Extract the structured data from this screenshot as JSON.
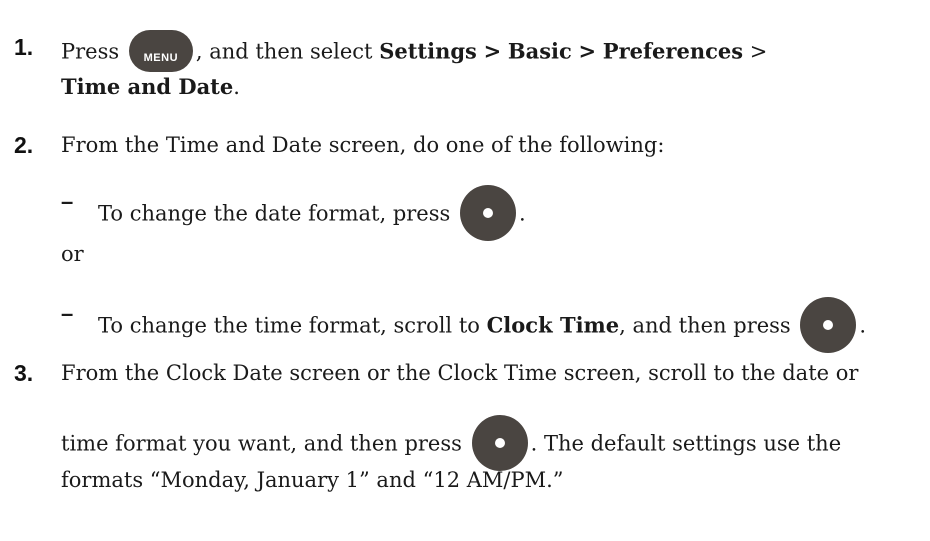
{
  "steps": [
    {
      "number": "1.",
      "line1": {
        "pre": "Press",
        "button": "MENU",
        "mid": ", and then select",
        "b1": "Settings",
        "sep1": ">",
        "b2": "Basic",
        "sep2": ">",
        "b3": "Preferences",
        "sep3": ">"
      },
      "line2": {
        "b4": "Time and Date",
        "end": "."
      }
    },
    {
      "number": "2.",
      "text": "From the Time and Date screen, do one of the following:",
      "option_a": {
        "dash": "–",
        "text": "To change the date format, press",
        "end": "."
      },
      "or": "or",
      "option_b": {
        "dash": "–",
        "pre": "To change the time format, scroll to",
        "bold": "Clock Time",
        "mid": ", and then press",
        "end": "."
      }
    },
    {
      "number": "3.",
      "line1": "From the Clock Date screen or the Clock Time screen, scroll to the date or",
      "line2_pre": "time format you want, and then press",
      "line2_post": ". The default settings use the",
      "line3": "formats “Monday, January 1” and “12 AM/PM.”"
    }
  ],
  "icons": {
    "menu_button": "menu-button-icon",
    "ok_button": "center-select-button-icon",
    "button_color": "#4a4541"
  }
}
